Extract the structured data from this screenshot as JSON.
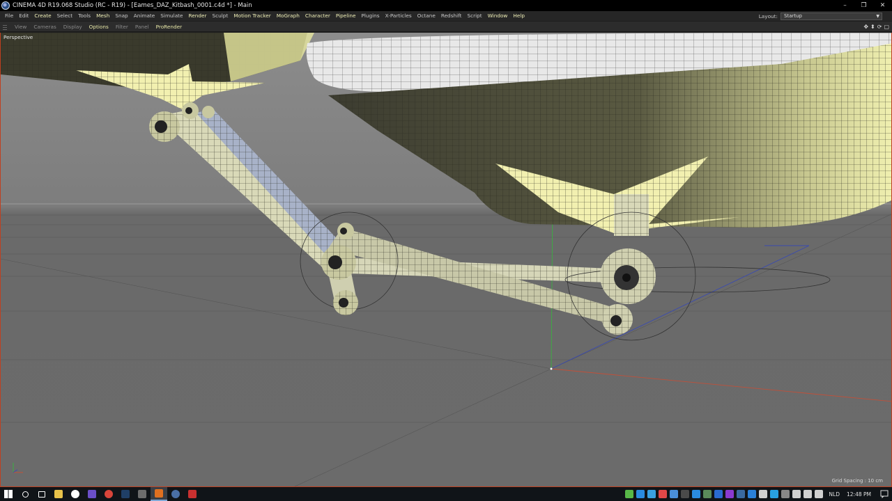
{
  "window": {
    "title": "CINEMA 4D R19.068 Studio (RC - R19) - [Eames_DAZ_Kitbash_0001.c4d *] - Main",
    "controls": [
      "–",
      "❐",
      "✕"
    ]
  },
  "menu": [
    {
      "label": "File",
      "strong": false
    },
    {
      "label": "Edit",
      "strong": false
    },
    {
      "label": "Create",
      "strong": true
    },
    {
      "label": "Select",
      "strong": false
    },
    {
      "label": "Tools",
      "strong": false
    },
    {
      "label": "Mesh",
      "strong": true
    },
    {
      "label": "Snap",
      "strong": false
    },
    {
      "label": "Animate",
      "strong": false
    },
    {
      "label": "Simulate",
      "strong": false
    },
    {
      "label": "Render",
      "strong": true
    },
    {
      "label": "Sculpt",
      "strong": false
    },
    {
      "label": "Motion Tracker",
      "strong": true
    },
    {
      "label": "MoGraph",
      "strong": true
    },
    {
      "label": "Character",
      "strong": true
    },
    {
      "label": "Pipeline",
      "strong": true
    },
    {
      "label": "Plugins",
      "strong": false
    },
    {
      "label": "X-Particles",
      "strong": false
    },
    {
      "label": "Octane",
      "strong": false
    },
    {
      "label": "Redshift",
      "strong": false
    },
    {
      "label": "Script",
      "strong": false
    },
    {
      "label": "Window",
      "strong": true
    },
    {
      "label": "Help",
      "strong": true
    }
  ],
  "layout": {
    "label": "Layout:",
    "value": "Startup"
  },
  "viewport_menu": [
    {
      "label": "View",
      "hl": false
    },
    {
      "label": "Cameras",
      "hl": false
    },
    {
      "label": "Display",
      "hl": false
    },
    {
      "label": "Options",
      "hl": true
    },
    {
      "label": "Filter",
      "hl": false
    },
    {
      "label": "Panel",
      "hl": false
    },
    {
      "label": "ProRender",
      "hl": true
    }
  ],
  "viewport": {
    "camera_label": "Perspective",
    "grid_spacing": "Grid Spacing : 10 cm"
  },
  "taskbar": {
    "apps": [
      {
        "name": "start-icon",
        "color": "#ffffff"
      },
      {
        "name": "search-icon",
        "color": "#ffffff"
      },
      {
        "name": "task-view-icon",
        "color": "#ffffff"
      },
      {
        "name": "file-explorer-icon",
        "color": "#e8c24a"
      },
      {
        "name": "settings-icon",
        "color": "#ffffff"
      },
      {
        "name": "app-purple-icon",
        "color": "#6b4fc8"
      },
      {
        "name": "chrome-icon",
        "color": "#d9453a"
      },
      {
        "name": "photoshop-icon",
        "color": "#1f3f66"
      },
      {
        "name": "calculator-icon",
        "color": "#6d6d6d"
      },
      {
        "name": "app-orange-icon",
        "color": "#e07020"
      },
      {
        "name": "cinema4d-icon",
        "color": "#4a6fa5"
      },
      {
        "name": "app-red-icon",
        "color": "#c83030"
      }
    ],
    "active_index": 9,
    "tray_colors": [
      "#58b848",
      "#2a8be0",
      "#3aa0e0",
      "#e04848",
      "#4a8fd8",
      "#4a4a4a",
      "#2a8be0",
      "#5a8a5a",
      "#2a6ad0",
      "#8a3ad0",
      "#3a6aa0",
      "#2a80d8",
      "#d0d0d0",
      "#28a0e0",
      "#888888",
      "#d0d0d0",
      "#d0d0d0",
      "#d0d0d0"
    ],
    "language": "NLD",
    "clock": "12:48 PM"
  }
}
